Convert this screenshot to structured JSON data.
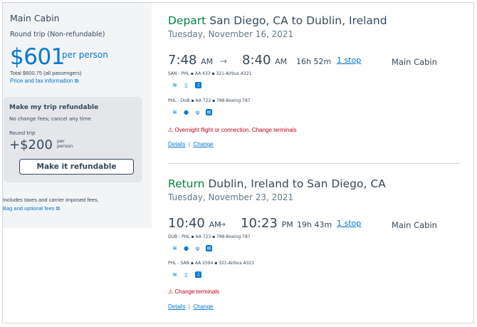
{
  "summary": {
    "cabin_title": "Main Cabin",
    "fare_type": "Round trip (Non-refundable)",
    "price": "$601",
    "per_person": "per person",
    "total": "Total $600.75 (all passengers)",
    "price_tax_link": "Price and tax information",
    "refund_box": {
      "title": "Make my trip refundable",
      "subtitle": "No change fees; cancel any time",
      "round_trip": "Round trip",
      "price": "+$200",
      "per_person": "per person",
      "button": "Make it refundable"
    },
    "includes_text": "Includes taxes and carrier imposed fees.",
    "bag_link": "Bag and optional fees"
  },
  "depart": {
    "label": "Depart",
    "route": "San Diego, CA to Dublin, Ireland",
    "date": "Tuesday, November 16, 2021",
    "dep_time": "7:48",
    "dep_ampm": "AM",
    "arr_time": "8:40",
    "arr_ampm": "AM",
    "duration": "16h 52m",
    "stops": "1 stop",
    "cabin": "Main Cabin",
    "segments": [
      {
        "text": "SAN - PHL  ▪  AA 433  ▪  321-Airbus A321"
      },
      {
        "text": "PHL - DUB  ▪  AA 722  ▪  788-Boeing 787"
      }
    ],
    "warning": "Overnight flight or connection. Change terminals",
    "details_link": "Details",
    "change_link": "Change"
  },
  "return": {
    "label": "Return",
    "route": "Dublin, Ireland to San Diego, CA",
    "date": "Tuesday, November 23, 2021",
    "dep_time": "10:40",
    "dep_ampm": "AM",
    "arr_time": "10:23",
    "arr_ampm": "PM",
    "duration": "19h 43m",
    "stops": "1 stop",
    "cabin": "Main Cabin",
    "segments": [
      {
        "text": "DUB - PHL  ▪  AA 723  ▪  788-Boeing 787"
      },
      {
        "text": "PHL - SAN  ▪  AA 2594  ▪  321-Airbus A321"
      }
    ],
    "warning": "Change terminals",
    "details_link": "Details",
    "change_link": "Change"
  },
  "separator": "|",
  "arrow": "→",
  "colors": {
    "accent": "#0078d2",
    "green": "#00853f",
    "warning": "#c30019"
  }
}
